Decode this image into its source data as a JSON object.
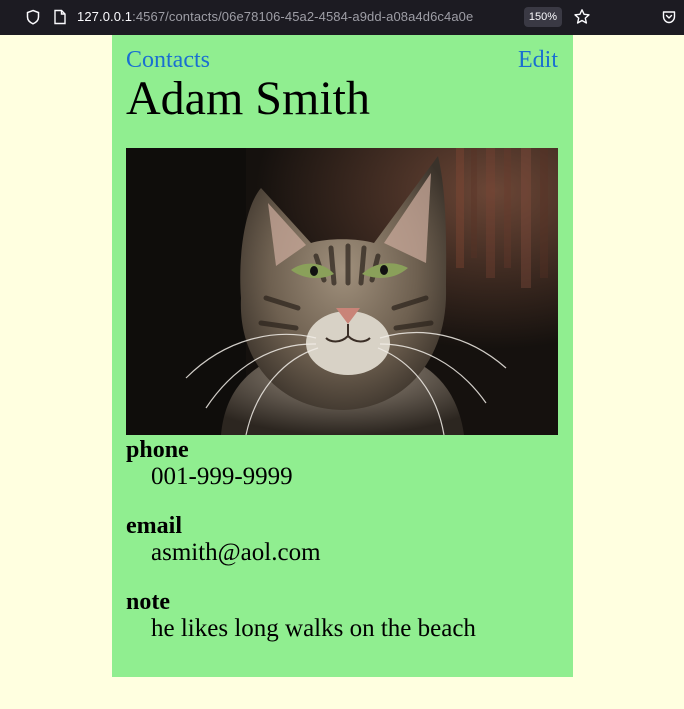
{
  "browser": {
    "url_host": "127.0.0.1",
    "url_rest": ":4567/contacts/06e78106-45a2-4584-a9dd-a08a4d6c4a0e",
    "zoom": "150%"
  },
  "nav": {
    "contacts_link": "Contacts",
    "edit_link": "Edit"
  },
  "contact": {
    "name": "Adam Smith",
    "fields": {
      "phone": {
        "label": "phone",
        "value": "001-999-9999"
      },
      "email": {
        "label": "email",
        "value": "asmith@aol.com"
      },
      "note": {
        "label": "note",
        "value": "he likes long walks on the beach"
      }
    }
  },
  "colors": {
    "page_background": "#ffffe0",
    "card_background": "#90ee90",
    "link": "#1a6fd1"
  }
}
